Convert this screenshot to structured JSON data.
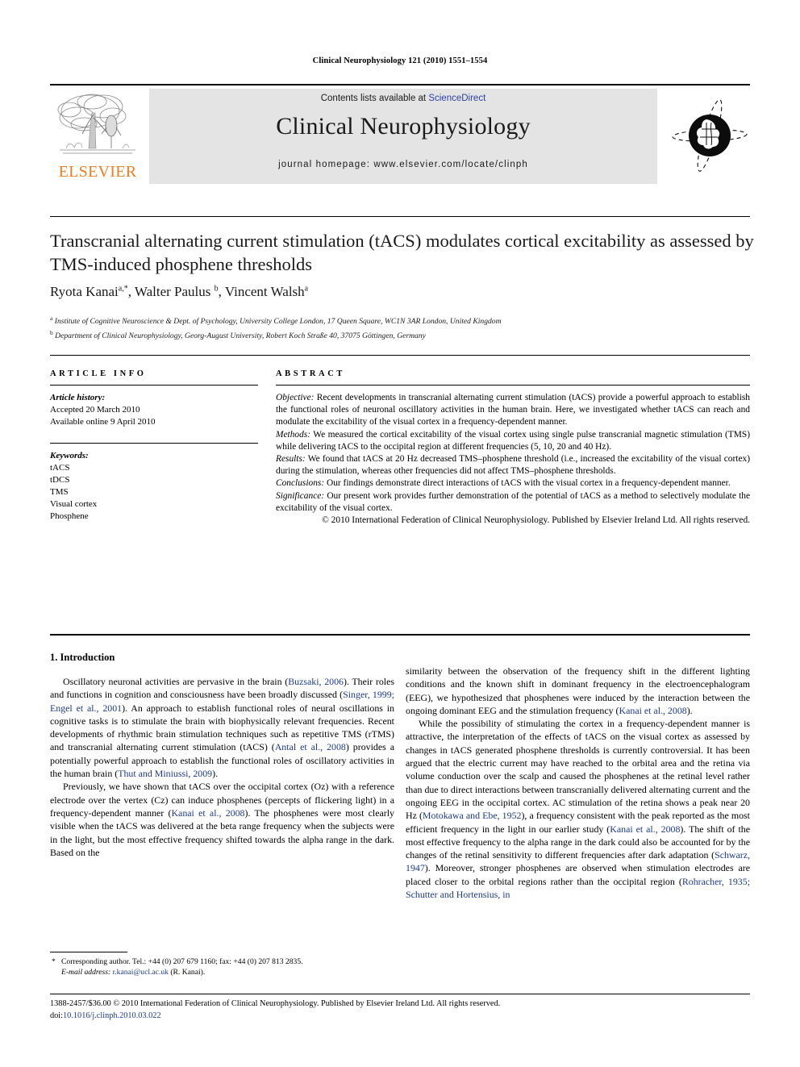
{
  "running_head": "Clinical Neurophysiology 121 (2010) 1551–1554",
  "masthead": {
    "contents_prefix": "Contents lists available at ",
    "sciencedirect": "ScienceDirect",
    "journal_title": "Clinical Neurophysiology",
    "homepage": "journal homepage: www.elsevier.com/locate/clinph",
    "publisher_wordmark": "ELSEVIER",
    "publisher_color": "#ef7d22",
    "link_color": "#2b3ea8",
    "band_color": "#e4e4e4"
  },
  "article": {
    "title": "Transcranial alternating current stimulation (tACS) modulates cortical excitability as assessed by TMS-induced phosphene thresholds",
    "authors_html": "Ryota Kanai<sup>a,*</sup>, Walter Paulus <sup>b</sup>, Vincent Walsh<sup>a</sup>",
    "affiliation_a": "Institute of Cognitive Neuroscience & Dept. of Psychology, University College London, 17 Queen Square, WC1N 3AR London, United Kingdom",
    "affiliation_b": "Department of Clinical Neurophysiology, Georg-August University, Robert Koch Straße 40, 37075 Göttingen, Germany"
  },
  "info": {
    "heading": "ARTICLE INFO",
    "history_label": "Article history:",
    "history": [
      "Accepted 20 March 2010",
      "Available online 9 April 2010"
    ],
    "keywords_label": "Keywords:",
    "keywords": [
      "tACS",
      "tDCS",
      "TMS",
      "Visual cortex",
      "Phosphene"
    ]
  },
  "abstract": {
    "heading": "ABSTRACT",
    "sections": [
      {
        "label": "Objective:",
        "text": " Recent developments in transcranial alternating current stimulation (tACS) provide a powerful approach to establish the functional roles of neuronal oscillatory activities in the human brain. Here, we investigated whether tACS can reach and modulate the excitability of the visual cortex in a frequency-dependent manner."
      },
      {
        "label": "Methods:",
        "text": " We measured the cortical excitability of the visual cortex using single pulse transcranial magnetic stimulation (TMS) while delivering tACS to the occipital region at different frequencies (5, 10, 20 and 40 Hz)."
      },
      {
        "label": "Results:",
        "text": " We found that tACS at 20 Hz decreased TMS–phosphene threshold (i.e., increased the excitability of the visual cortex) during the stimulation, whereas other frequencies did not affect TMS–phosphene thresholds."
      },
      {
        "label": "Conclusions:",
        "text": " Our findings demonstrate direct interactions of tACS with the visual cortex in a frequency-dependent manner."
      },
      {
        "label": "Significance:",
        "text": " Our present work provides further demonstration of the potential of tACS as a method to selectively modulate the excitability of the visual cortex."
      }
    ],
    "copyright": "© 2010 International Federation of Clinical Neurophysiology. Published by Elsevier Ireland Ltd. All rights reserved."
  },
  "body": {
    "section_heading": "1. Introduction",
    "left_paragraphs": [
      "Oscillatory neuronal activities are pervasive in the brain (<span class=\"ref\">Buzsaki, 2006</span>). Their roles and functions in cognition and consciousness have been broadly discussed (<span class=\"ref\">Singer, 1999; Engel et al., 2001</span>). An approach to establish functional roles of neural oscillations in cognitive tasks is to stimulate the brain with biophysically relevant frequencies. Recent developments of rhythmic brain stimulation techniques such as repetitive TMS (rTMS) and transcranial alternating current stimulation (tACS) (<span class=\"ref\">Antal et al., 2008</span>) provides a potentially powerful approach to establish the functional roles of oscillatory activities in the human brain (<span class=\"ref\">Thut and Miniussi, 2009</span>).",
      "Previously, we have shown that tACS over the occipital cortex (Oz) with a reference electrode over the vertex (Cz) can induce phosphenes (percepts of flickering light) in a frequency-dependent manner (<span class=\"ref\">Kanai et al., 2008</span>). The phosphenes were most clearly visible when the tACS was delivered at the beta range frequency when the subjects were in the light, but the most effective frequency shifted towards the alpha range in the dark. Based on the"
    ],
    "right_paragraphs": [
      "similarity between the observation of the frequency shift in the different lighting conditions and the known shift in dominant frequency in the electroencephalogram (EEG), we hypothesized that phosphenes were induced by the interaction between the ongoing dominant EEG and the stimulation frequency (<span class=\"ref\">Kanai et al., 2008</span>).",
      "While the possibility of stimulating the cortex in a frequency-dependent manner is attractive, the interpretation of the effects of tACS on the visual cortex as assessed by changes in tACS generated phosphene thresholds is currently controversial. It has been argued that the electric current may have reached to the orbital area and the retina via volume conduction over the scalp and caused the phosphenes at the retinal level rather than due to direct interactions between transcranially delivered alternating current and the ongoing EEG in the occipital cortex. AC stimulation of the retina shows a peak near 20 Hz (<span class=\"ref\">Motokawa and Ebe, 1952</span>), a frequency consistent with the peak reported as the most efficient frequency in the light in our earlier study (<span class=\"ref\">Kanai et al., 2008</span>). The shift of the most effective frequency to the alpha range in the dark could also be accounted for by the changes of the retinal sensitivity to different frequencies after dark adaptation (<span class=\"ref\">Schwarz, 1947</span>). Moreover, stronger phosphenes are observed when stimulation electrodes are placed closer to the orbital regions rather than the occipital region (<span class=\"ref\">Rohracher, 1935; Schutter and Hortensius, in</span>"
    ]
  },
  "footnote": {
    "marker": "*",
    "line1": "Corresponding author. Tel.: +44 (0) 207 679 1160; fax: +44 (0) 207 813 2835.",
    "email_label": "E-mail address:",
    "email": "r.kanai@ucl.ac.uk",
    "email_owner": "(R. Kanai)."
  },
  "colophon": {
    "line1": "1388-2457/$36.00 © 2010 International Federation of Clinical Neurophysiology. Published by Elsevier Ireland Ltd. All rights reserved.",
    "doi_label": "doi:",
    "doi": "10.1016/j.clinph.2010.03.022"
  }
}
